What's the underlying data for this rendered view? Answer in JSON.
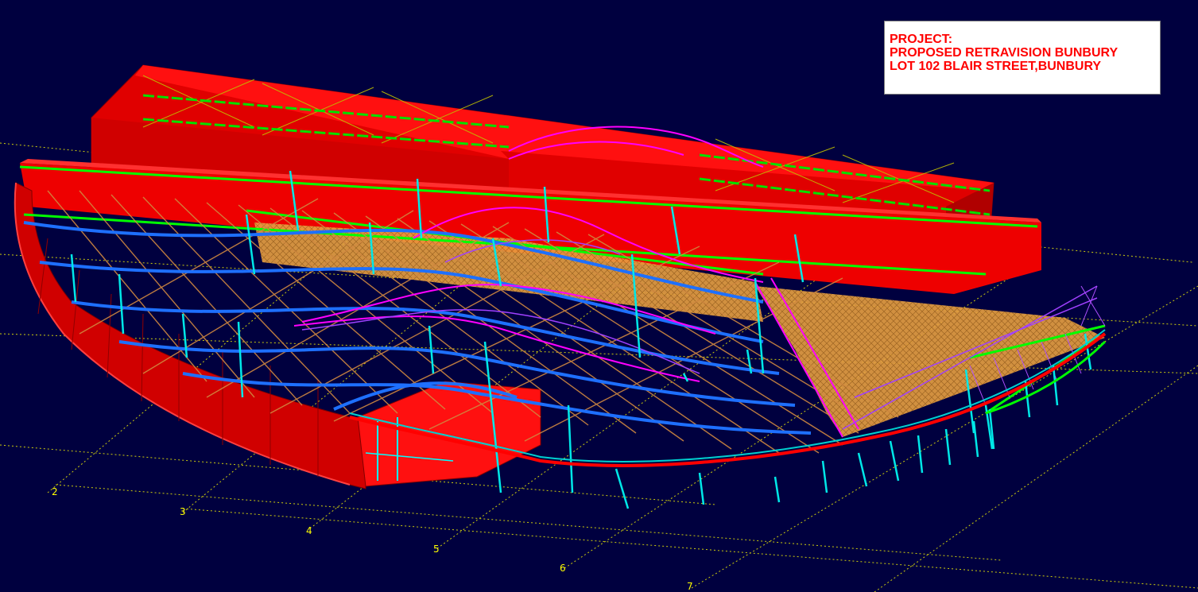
{
  "project_box": {
    "line1": "PROJECT:",
    "line2": "PROPOSED RETRAVISION BUNBURY",
    "line3": "LOT 102 BLAIR STREET,BUNBURY"
  },
  "grid_labels": [
    "2",
    "3",
    "4",
    "5",
    "6",
    "7"
  ],
  "colors": {
    "background": "#00003f",
    "wall": "#ff0000",
    "grid": "#ffff00",
    "column": "#00ffff",
    "rafter": "#c08040",
    "purlin": "#00ff00",
    "beam": "#0080ff",
    "truss": "#ff00ff",
    "deck": "#e0a040"
  }
}
